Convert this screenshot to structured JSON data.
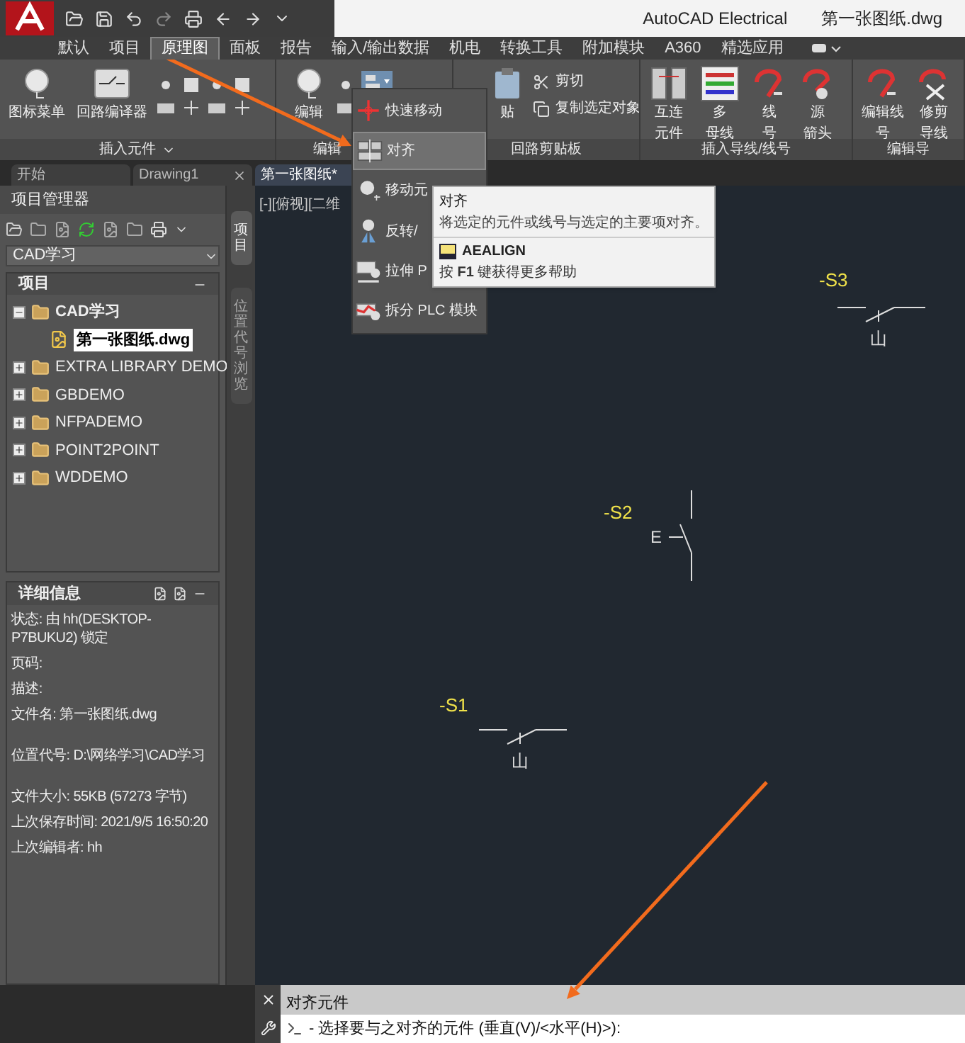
{
  "title_bar": {
    "app_name": "AutoCAD Electrical",
    "document": "第一张图纸.dwg"
  },
  "menu_tabs": [
    {
      "label": "默认",
      "selected": false
    },
    {
      "label": "项目",
      "selected": false
    },
    {
      "label": "原理图",
      "selected": true
    },
    {
      "label": "面板",
      "selected": false
    },
    {
      "label": "报告",
      "selected": false
    },
    {
      "label": "输入/输出数据",
      "selected": false
    },
    {
      "label": "机电",
      "selected": false
    },
    {
      "label": "转换工具",
      "selected": false
    },
    {
      "label": "附加模块",
      "selected": false
    },
    {
      "label": "A360",
      "selected": false
    },
    {
      "label": "精选应用",
      "selected": false
    }
  ],
  "ribbon": {
    "panels": [
      {
        "label": "插入元件",
        "menu": true,
        "buttons": [
          {
            "lines": [
              "图标菜单"
            ]
          },
          {
            "lines": [
              "回路编译器"
            ]
          }
        ]
      },
      {
        "label": "编辑",
        "buttons": [
          {
            "lines": [
              "编辑"
            ]
          }
        ]
      },
      {
        "label": "回路剪贴板",
        "buttons": [
          {
            "lines": [
              "贴"
            ]
          }
        ],
        "small": [
          "剪切",
          "复制选定对象"
        ]
      },
      {
        "label": "插入导线/线号",
        "buttons": [
          {
            "lines": [
              "互连",
              "元件"
            ]
          },
          {
            "lines": [
              "多",
              "母线"
            ]
          },
          {
            "lines": [
              "线",
              "号"
            ]
          },
          {
            "lines": [
              "源",
              "箭头"
            ]
          }
        ]
      },
      {
        "label": "编辑导",
        "buttons": [
          {
            "lines": [
              "编辑线",
              "号"
            ]
          },
          {
            "lines": [
              "修剪",
              "导线"
            ]
          }
        ]
      }
    ]
  },
  "doc_tabs": [
    {
      "label": "开始",
      "selected": false,
      "closable": false
    },
    {
      "label": "Drawing1",
      "selected": false,
      "closable": true
    },
    {
      "label": "第一张图纸*",
      "selected": true,
      "closable": false
    }
  ],
  "project_manager": {
    "title": "项目管理器",
    "project_select": "CAD学习",
    "tree_header": "项目",
    "tree": [
      {
        "label": "CAD学习",
        "expanded": true,
        "active": true,
        "children": [
          {
            "label": "第一张图纸.dwg",
            "selected": true
          }
        ]
      },
      {
        "label": "EXTRA LIBRARY DEMO",
        "expanded": false,
        "active": false
      },
      {
        "label": "GBDEMO",
        "expanded": false,
        "active": false
      },
      {
        "label": "NFPADEMO",
        "expanded": false,
        "active": false
      },
      {
        "label": "POINT2POINT",
        "expanded": false,
        "active": false
      },
      {
        "label": "WDDEMO",
        "expanded": false,
        "active": false
      }
    ],
    "details_title": "详细信息",
    "details": [
      [
        "状态: 由 hh(DESKTOP-P7BUKU2) 锁定",
        "页码:",
        "描述:",
        "文件名: 第一张图纸.dwg"
      ],
      [
        "位置代号: D:\\网络学习\\CAD学习"
      ],
      [
        "文件大小: 55KB (57273 字节)",
        "上次保存时间: 2021/9/5 16:50:20",
        "上次编辑者: hh"
      ]
    ]
  },
  "side_tabs": [
    {
      "label": "项目",
      "selected": true
    },
    {
      "label": "位置代号浏览",
      "selected": false
    }
  ],
  "viewport": {
    "label": "[-][俯视][二维"
  },
  "components": [
    {
      "tag": "-S3",
      "kind": "horizontal",
      "mark": "山"
    },
    {
      "tag": "-S2",
      "kind": "vertical",
      "mark": "E"
    },
    {
      "tag": "-S1",
      "kind": "horizontal",
      "mark": "山"
    }
  ],
  "dropdown_menu": [
    {
      "label": "快速移动",
      "selected": false
    },
    {
      "label": "对齐",
      "selected": true
    },
    {
      "label": "移动元",
      "selected": false
    },
    {
      "label": "反转/",
      "selected": false
    },
    {
      "label": "拉伸 P",
      "selected": false
    },
    {
      "label": "拆分 PLC 模块",
      "selected": false
    }
  ],
  "tooltip": {
    "title": "对齐",
    "description": "将选定的元件或线号与选定的主要项对齐。",
    "command": "AEALIGN",
    "help": "按 **F1** 键获得更多帮助"
  },
  "command_line": {
    "history": "对齐元件",
    "prompt": "- 选择要与之对齐的元件 (垂直(V)/<水平(H)>):"
  }
}
